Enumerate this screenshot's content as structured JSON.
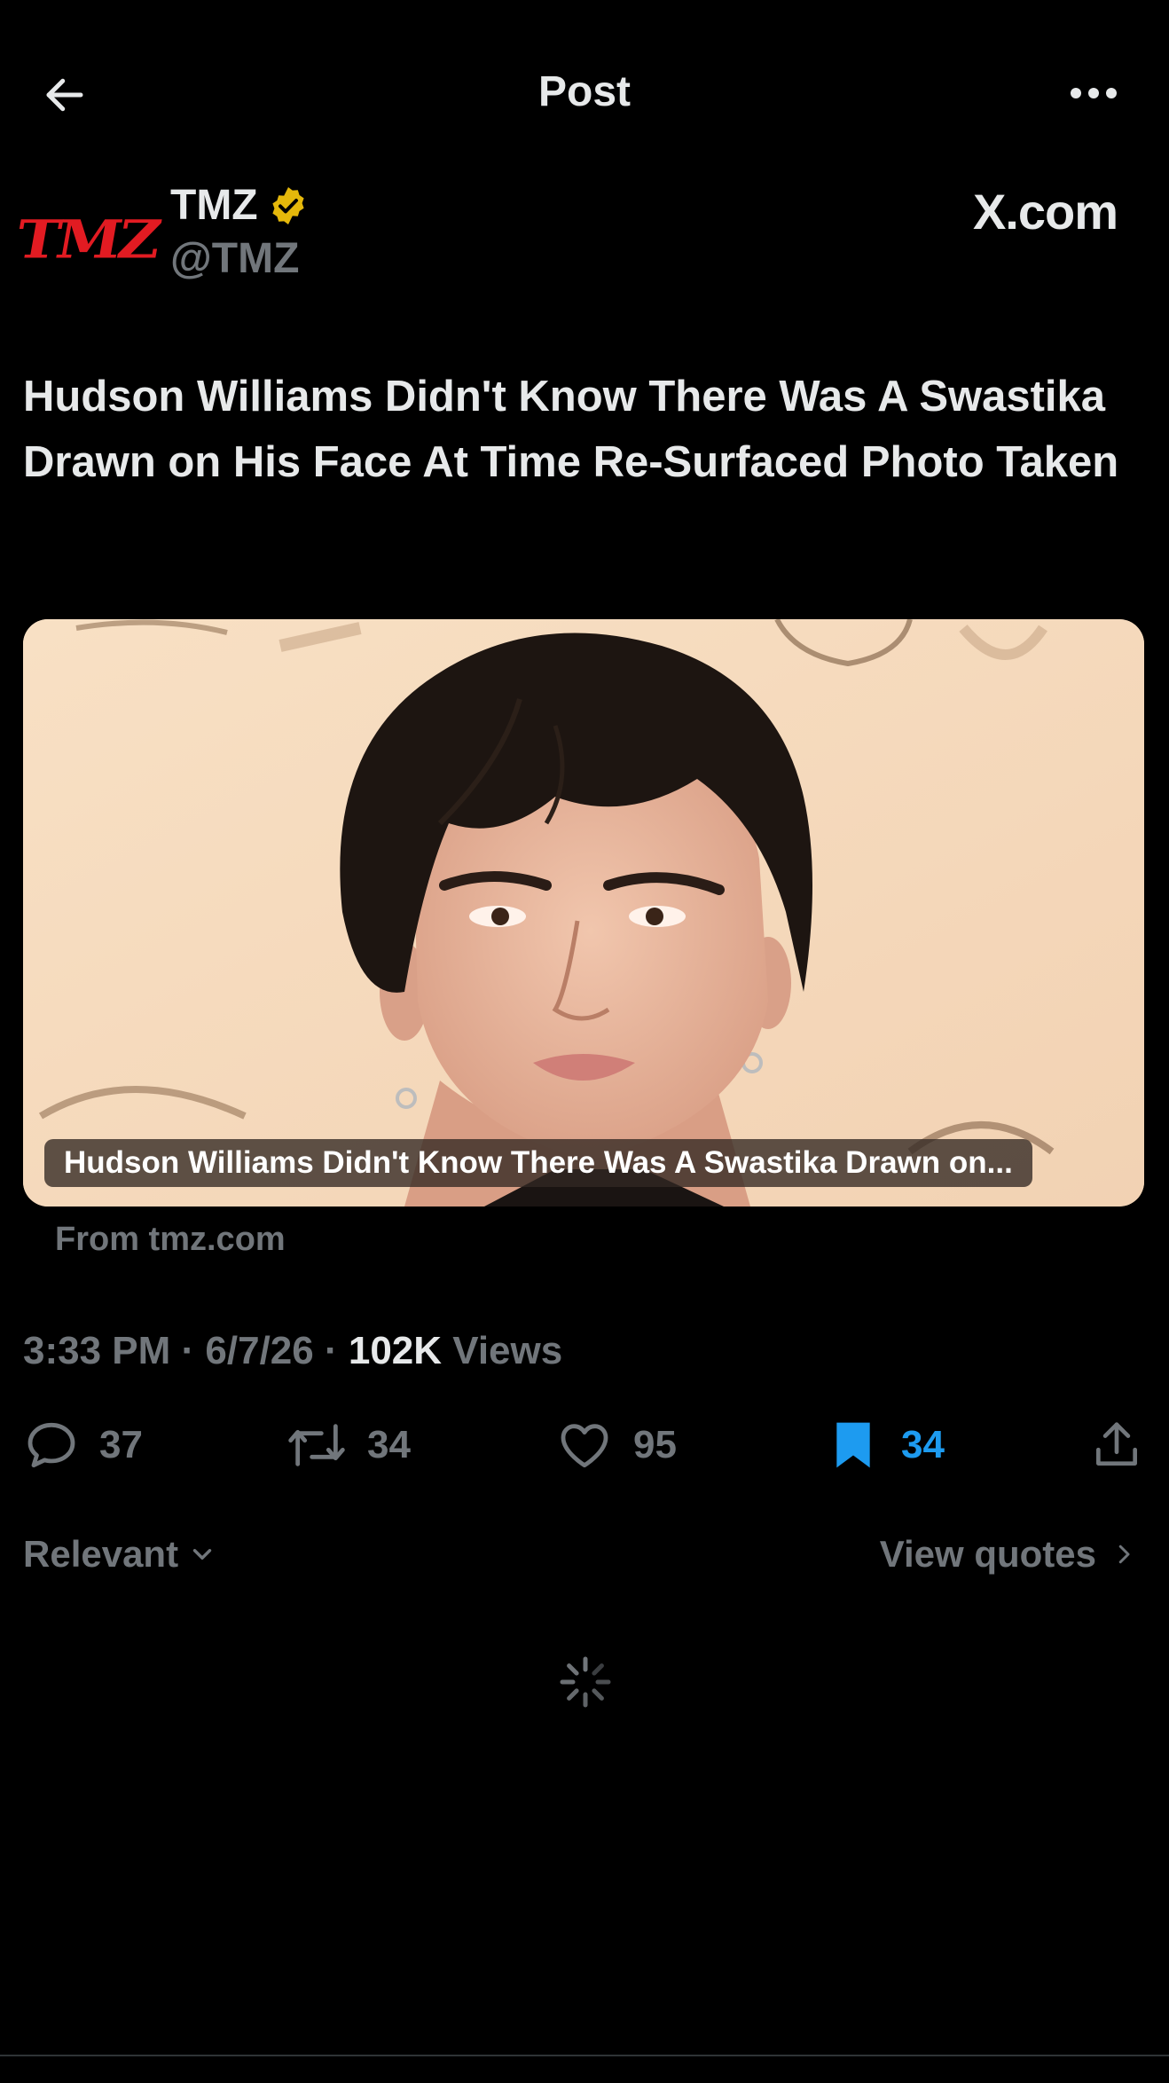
{
  "header": {
    "title": "Post",
    "back_icon": "arrow-left-icon",
    "more_icon": "ellipsis-icon"
  },
  "author": {
    "display_name": "TMZ",
    "handle": "@TMZ",
    "avatar_text": "TMZ",
    "verified_color": "#e5b80b",
    "brand_tag": "X.com"
  },
  "post": {
    "headline": "Hudson Williams Didn't Know There Was A Swastika Drawn on His Face At Time Re-Surfaced Photo Taken"
  },
  "card": {
    "caption": "Hudson Williams Didn't Know There Was A Swastika Drawn on...",
    "source": "From tmz.com"
  },
  "meta": {
    "time": "3:33 PM",
    "date": "6/7/26",
    "views_count": "102K",
    "views_label": "Views"
  },
  "actions": {
    "replies": "37",
    "reposts": "34",
    "likes": "95",
    "bookmarks": "34",
    "bookmark_color": "#1d9bf0"
  },
  "replies_section": {
    "sort_label": "Relevant",
    "quotes_label": "View quotes"
  }
}
